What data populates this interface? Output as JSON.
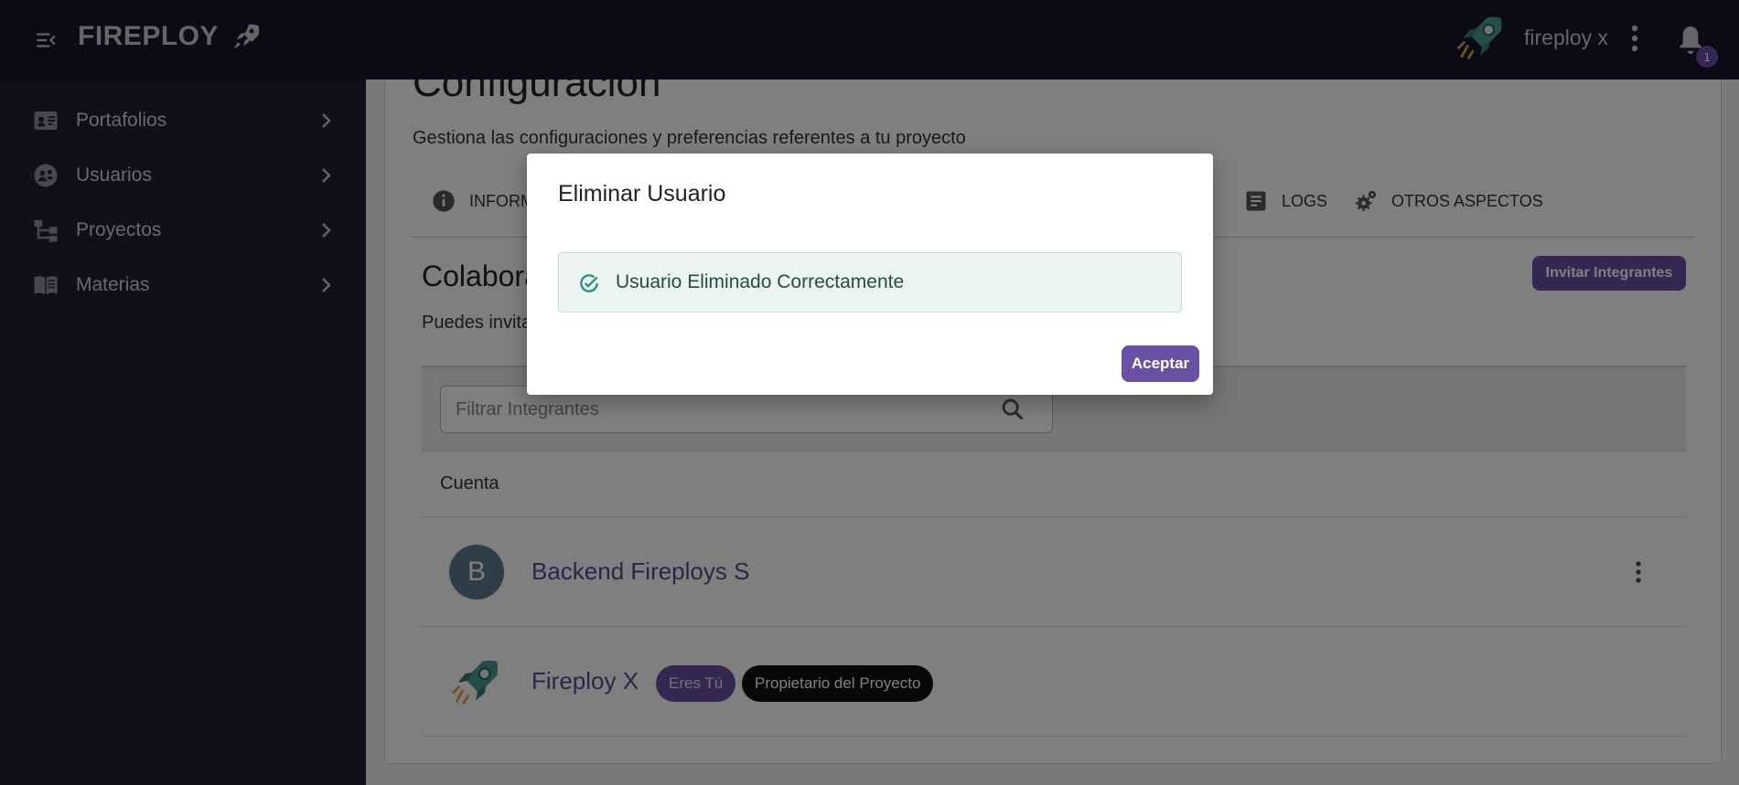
{
  "app": {
    "brand": "FIREPLOY",
    "user_name": "fireploy x",
    "notification_count": "1",
    "icons": {
      "menu": "menu-collapse-icon",
      "brand": "rocket-icon",
      "user": "rocket-avatar-icon",
      "more": "kebab-icon",
      "notifications": "bell-icon"
    }
  },
  "sidebar": {
    "items": [
      {
        "label": "Portafolios",
        "icon": "portfolio-card-icon"
      },
      {
        "label": "Usuarios",
        "icon": "users-icon"
      },
      {
        "label": "Proyectos",
        "icon": "project-tree-icon"
      },
      {
        "label": "Materias",
        "icon": "book-icon"
      }
    ]
  },
  "page": {
    "title": "Configuración",
    "subtitle": "Gestiona las configuraciones y preferencias referentes a tu proyecto",
    "tabs": [
      {
        "label": "INFORM",
        "icon": "info-icon"
      },
      {
        "label": "LOGS",
        "icon": "document-icon"
      },
      {
        "label": "OTROS ASPECTOS",
        "icon": "gears-icon"
      }
    ]
  },
  "collaborators": {
    "title": "Colabora",
    "description": "Puedes invita",
    "invite_button": "Invitar Integrantes",
    "filter_placeholder": "Filtrar Integrantes",
    "column_header": "Cuenta",
    "rows": [
      {
        "avatar_letter": "B",
        "name": "Backend Fireploys S"
      },
      {
        "name": "Fireploy X",
        "chips": [
          "Eres Tú",
          "Propietario del Proyecto"
        ]
      }
    ]
  },
  "modal": {
    "title": "Eliminar Usuario",
    "message": "Usuario Eliminado Correctamente",
    "accept_button": "Aceptar"
  },
  "colors": {
    "topbar": "#15162a",
    "sidebar": "#1f2033",
    "accent": "#6b4fa2",
    "success_bg": "#ebf4f1"
  }
}
